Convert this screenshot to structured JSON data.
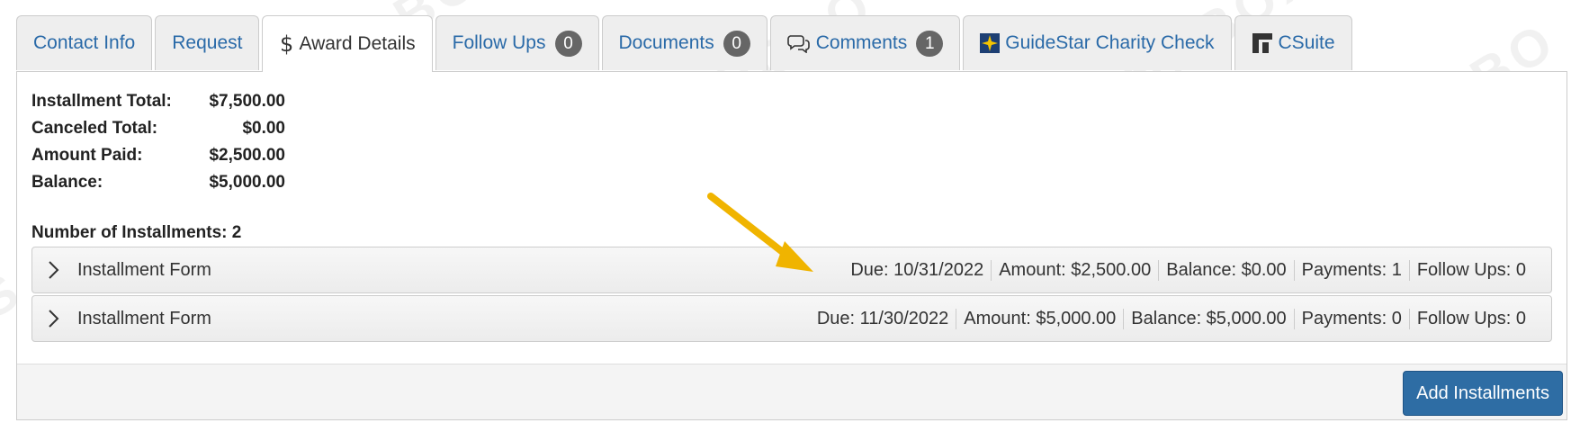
{
  "tabs": [
    {
      "label": "Contact Info",
      "icon": "",
      "badge": null
    },
    {
      "label": "Request",
      "icon": "",
      "badge": null
    },
    {
      "label": "Award Details",
      "icon": "dollar-icon",
      "badge": null,
      "active": true
    },
    {
      "label": "Follow Ups",
      "icon": "",
      "badge": "0"
    },
    {
      "label": "Documents",
      "icon": "",
      "badge": "0"
    },
    {
      "label": "Comments",
      "icon": "comments-icon",
      "badge": "1"
    },
    {
      "label": "GuideStar Charity Check",
      "icon": "guidestar-icon",
      "badge": null
    },
    {
      "label": "CSuite",
      "icon": "csuite-icon",
      "badge": null
    }
  ],
  "totals": [
    {
      "label": "Installment Total:",
      "value": "$7,500.00"
    },
    {
      "label": "Canceled Total:",
      "value": "$0.00"
    },
    {
      "label": "Amount Paid:",
      "value": "$2,500.00"
    },
    {
      "label": "Balance:",
      "value": "$5,000.00"
    }
  ],
  "installments_header": "Number of Installments: 2",
  "installments": [
    {
      "title": "Installment Form",
      "due": "Due: 10/31/2022",
      "amount": "Amount: $2,500.00",
      "balance": "Balance: $0.00",
      "payments": "Payments: 1",
      "follow_ups": "Follow Ups: 0"
    },
    {
      "title": "Installment Form",
      "due": "Due: 11/30/2022",
      "amount": "Amount: $5,000.00",
      "balance": "Balance: $5,000.00",
      "payments": "Payments: 0",
      "follow_ups": "Follow Ups: 0"
    }
  ],
  "actions": {
    "add_installments": "Add Installments"
  },
  "colors": {
    "link": "#2a6aa8",
    "primary_button": "#2e6da4",
    "badge": "#666666",
    "arrow": "#f0b400"
  }
}
